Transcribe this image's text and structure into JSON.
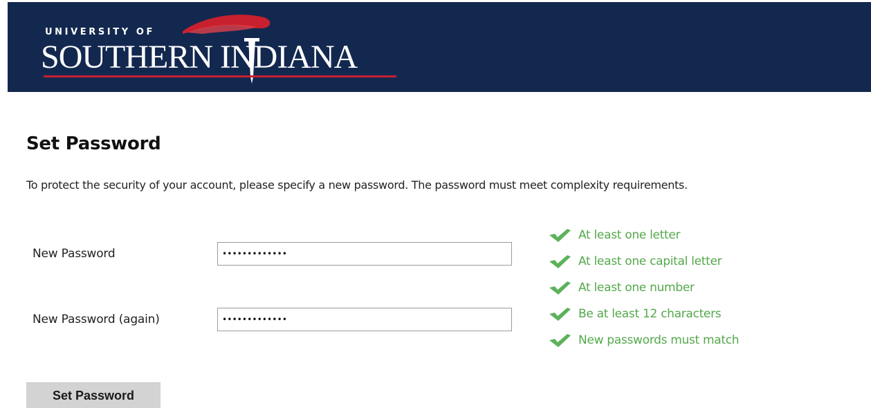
{
  "header": {
    "logo_top": "UNIVERSITY OF",
    "logo_main": "SOUTHERN INDIANA",
    "colors": {
      "background": "#13284f",
      "accent": "#c8202f",
      "text": "#ffffff"
    }
  },
  "page": {
    "title": "Set Password",
    "intro": "To protect the security of your account, please specify a new password. The password must meet complexity requirements."
  },
  "form": {
    "new_password_label": "New Password",
    "new_password_value": "•••••••••••••",
    "confirm_password_label": "New Password (again)",
    "confirm_password_value": "•••••••••••••",
    "submit_label": "Set Password"
  },
  "requirements": [
    {
      "text": "At least one letter",
      "status": "met",
      "icon": "check-icon"
    },
    {
      "text": "At least one capital letter",
      "status": "met",
      "icon": "check-icon"
    },
    {
      "text": "At least one number",
      "status": "met",
      "icon": "check-icon"
    },
    {
      "text": "Be at least 12 characters",
      "status": "met",
      "icon": "check-icon"
    },
    {
      "text": "New passwords must match",
      "status": "met",
      "icon": "check-icon"
    }
  ],
  "colors": {
    "requirement_met": "#54a84b",
    "button_bg": "#d3d3d3"
  }
}
